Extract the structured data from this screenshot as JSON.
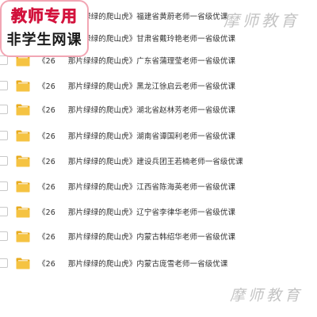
{
  "promo": {
    "line1": "教师专用",
    "line2": "非学生网课"
  },
  "watermarks": {
    "top": "摩师教育",
    "bottom": "摩师教育"
  },
  "files": [
    {
      "prefix": "《26",
      "title": "那片绿绿的爬山虎》福建省黄蔚老师一省级优课"
    },
    {
      "prefix": "《26",
      "title": "那片绿绿的爬山虎》甘肃省戴玲艳老师一省级优课"
    },
    {
      "prefix": "《26",
      "title": "那片绿绿的爬山虎》广东省蒲理莹老师一省级优课"
    },
    {
      "prefix": "《26",
      "title": "那片绿绿的爬山虎》黑龙江徐启云老师一省级优课"
    },
    {
      "prefix": "《26",
      "title": "那片绿绿的爬山虎》湖北省赵林芳老师一省级优课"
    },
    {
      "prefix": "《26",
      "title": "那片绿绿的爬山虎》湖南省谭国利老师一省级优课"
    },
    {
      "prefix": "《26",
      "title": "那片绿绿的爬山虎》建设兵团王若楠老师一省级优课"
    },
    {
      "prefix": "《26",
      "title": "那片绿绿的爬山虎》江西省陈海英老师一省级优课"
    },
    {
      "prefix": "《26",
      "title": "那片绿绿的爬山虎》辽宁省李律华老师一省级优课"
    },
    {
      "prefix": "《26",
      "title": "那片绿绿的爬山虎》内蒙古韩绍华老师一省级优课"
    },
    {
      "prefix": "《26",
      "title": "那片绿绿的爬山虎》内蒙古庞雪老师一省级优课"
    }
  ],
  "colors": {
    "folder": "#f5c342",
    "folder_tab": "#e8ab1f",
    "promo_red": "#ff2d57",
    "promo_border": "#f2a6b4"
  }
}
